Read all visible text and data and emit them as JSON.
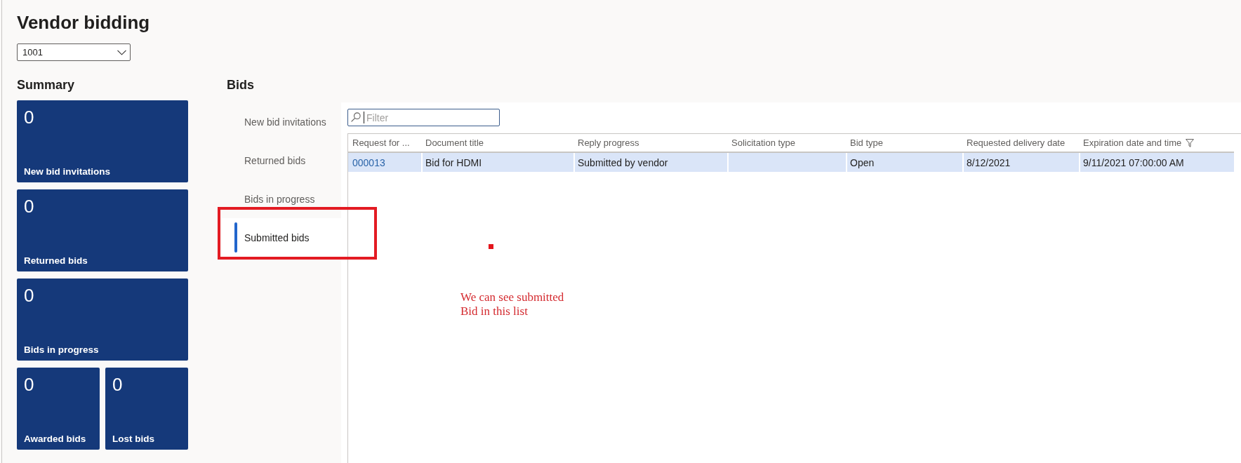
{
  "page": {
    "title": "Vendor bidding",
    "vendor_select": {
      "value": "1001"
    }
  },
  "summary": {
    "title": "Summary",
    "tile_rows": [
      [
        {
          "count": "0",
          "label": "New bid invitations"
        }
      ],
      [
        {
          "count": "0",
          "label": "Returned bids"
        }
      ],
      [
        {
          "count": "0",
          "label": "Bids in progress"
        }
      ],
      [
        {
          "count": "0",
          "label": "Awarded bids"
        },
        {
          "count": "0",
          "label": "Lost bids"
        }
      ]
    ]
  },
  "bids": {
    "title": "Bids",
    "tabs": [
      {
        "label": "New bid invitations",
        "selected": false,
        "callout": false
      },
      {
        "label": "Returned bids",
        "selected": false,
        "callout": false
      },
      {
        "label": "Bids in progress",
        "selected": false,
        "callout": false
      },
      {
        "label": "Submitted bids",
        "selected": true,
        "callout": true
      }
    ],
    "filter": {
      "placeholder": "Filter",
      "focused": true
    },
    "table": {
      "columns": [
        {
          "label": "Request for ...",
          "kind": "link",
          "filtered": false
        },
        {
          "label": "Document title",
          "kind": "text",
          "filtered": false
        },
        {
          "label": "Reply progress",
          "kind": "text",
          "filtered": false
        },
        {
          "label": "Solicitation type",
          "kind": "text",
          "filtered": false
        },
        {
          "label": "Bid type",
          "kind": "text",
          "filtered": false
        },
        {
          "label": "Requested delivery date",
          "kind": "text",
          "filtered": false
        },
        {
          "label": "Expiration date and time",
          "kind": "text",
          "filtered": true
        }
      ],
      "rows": [
        {
          "selected": true,
          "cells": [
            "000013",
            "Bid for HDMI",
            "Submitted by vendor",
            null,
            "Open",
            "8/12/2021",
            "9/11/2021 07:00:00 AM"
          ]
        }
      ]
    }
  },
  "annotation": {
    "note": "We can see submitted\nBid in this list"
  }
}
